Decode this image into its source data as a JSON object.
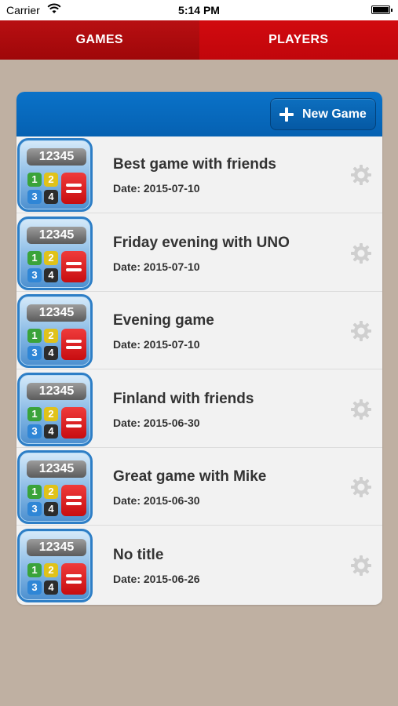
{
  "status_bar": {
    "carrier": "Carrier",
    "time": "5:14 PM",
    "wifi_icon": "wifi-icon",
    "battery_icon": "battery-icon"
  },
  "tabs": [
    {
      "label": "GAMES",
      "active": true
    },
    {
      "label": "PLAYERS",
      "active": false
    }
  ],
  "panel": {
    "new_game_label": "New Game",
    "new_game_icon": "plus-icon"
  },
  "app_icon": {
    "digits": "12345",
    "tiles": [
      "1",
      "2",
      "3",
      "4"
    ]
  },
  "games": [
    {
      "title": "Best game with friends",
      "date": "Date: 2015-07-10"
    },
    {
      "title": "Friday evening with UNO",
      "date": "Date: 2015-07-10"
    },
    {
      "title": "Evening game",
      "date": "Date: 2015-07-10"
    },
    {
      "title": "Finland with friends",
      "date": "Date: 2015-06-30"
    },
    {
      "title": "Great game with Mike",
      "date": "Date: 2015-06-30"
    },
    {
      "title": "No title",
      "date": "Date: 2015-06-26"
    }
  ],
  "colors": {
    "tab_red": "#c1060b",
    "tab_active_red": "#a3080a",
    "header_blue": "#0561b2",
    "background": "#bfb0a2"
  }
}
